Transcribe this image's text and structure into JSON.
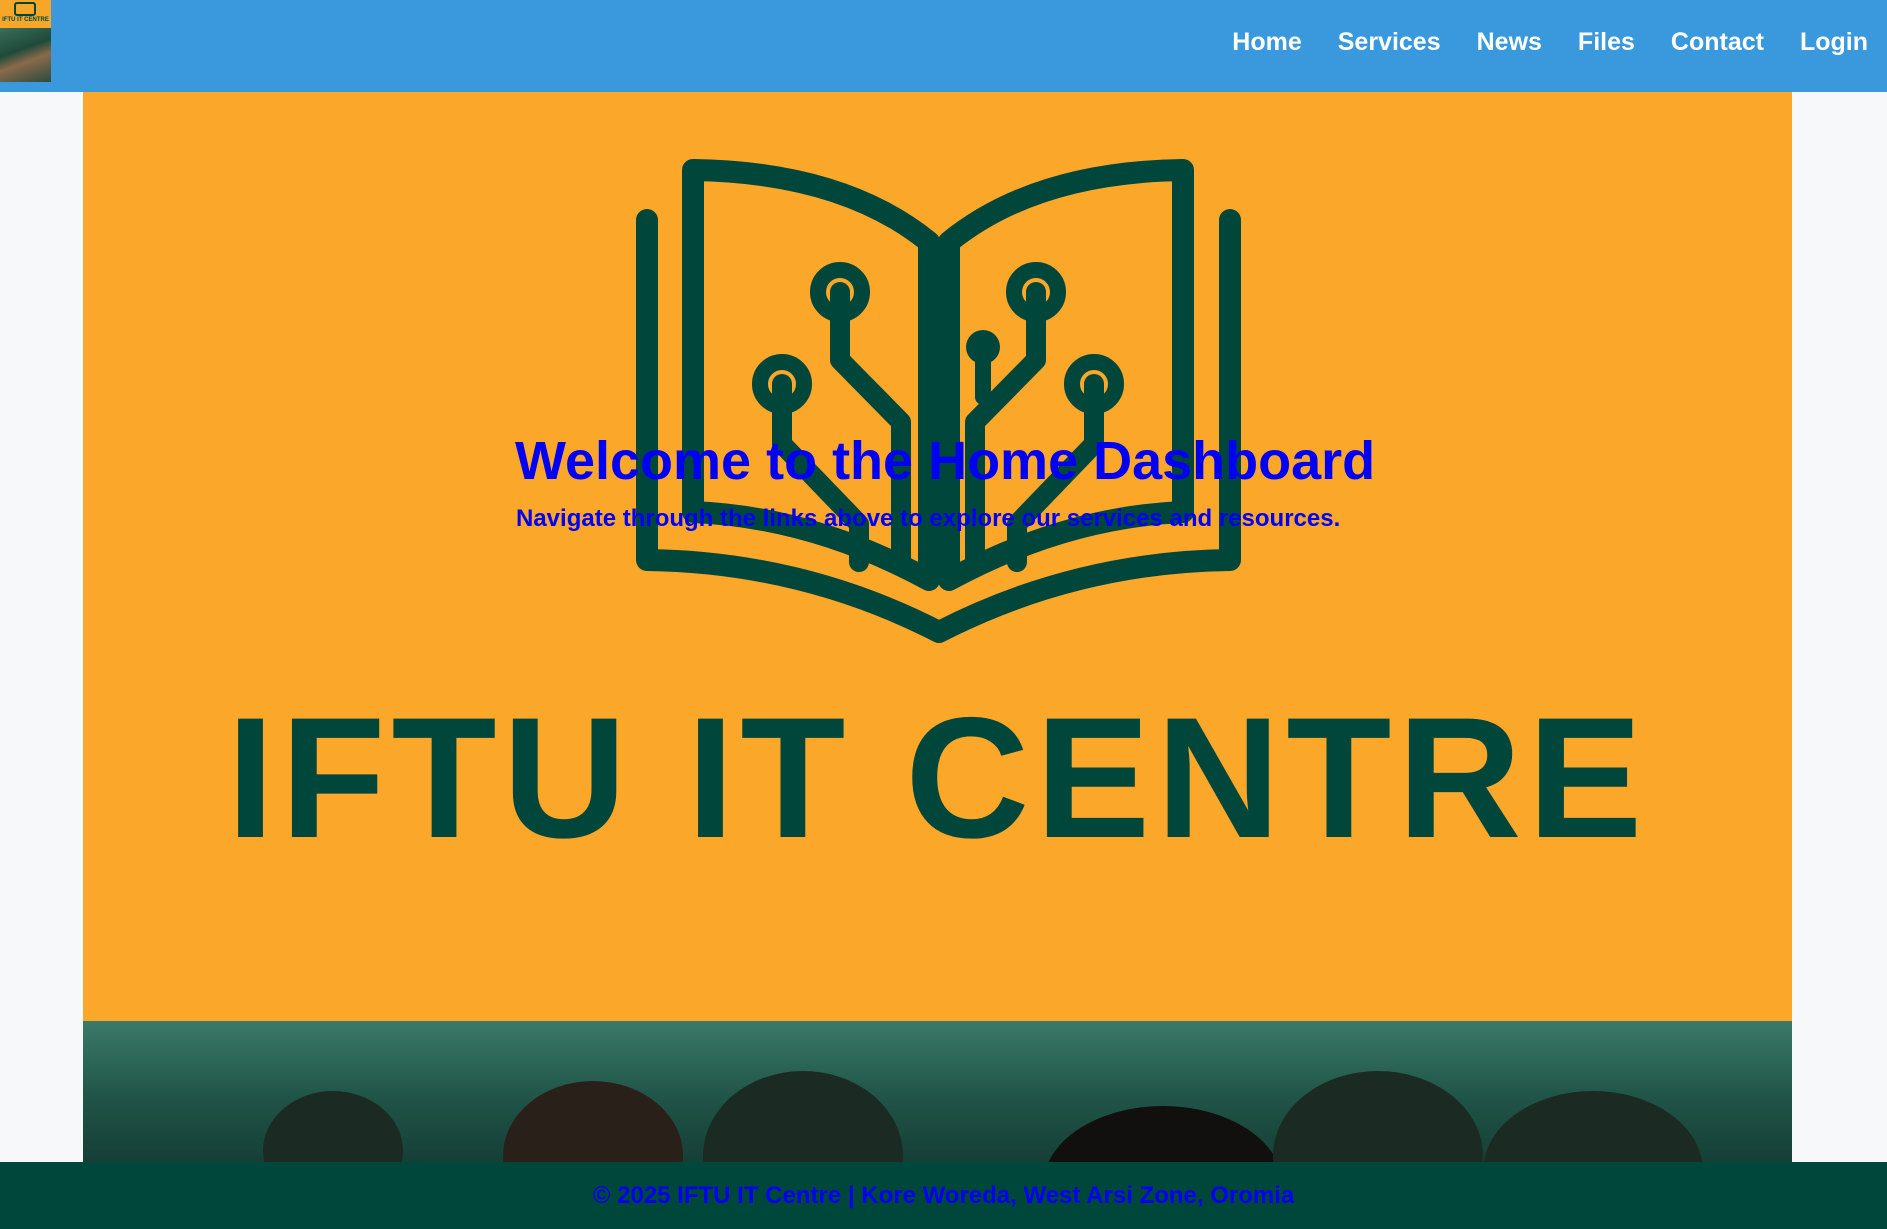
{
  "nav": {
    "logo_text": "IFTU IT CENTRE",
    "links": [
      "Home",
      "Services",
      "News",
      "Files",
      "Contact",
      "Login"
    ]
  },
  "hero": {
    "brand_text": "IFTU IT CENTRE",
    "title": "Welcome to the Home Dashboard",
    "subtitle": "Navigate through the links above to explore our services and resources."
  },
  "footer": {
    "text": "© 2025 IFTU IT Centre | Kore Woreda, West Arsi Zone, Oromia"
  },
  "colors": {
    "nav_bg": "#3a99dc",
    "hero_orange": "#fba72a",
    "brand_green": "#00463a",
    "text_blue": "#0000f5",
    "footer_bg": "#00473b"
  }
}
